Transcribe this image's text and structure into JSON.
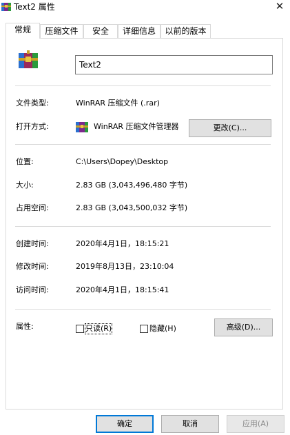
{
  "window": {
    "title": "Text2 属性",
    "close_glyph": "✕"
  },
  "tabs": [
    {
      "label": "常规",
      "active": true
    },
    {
      "label": "压缩文件",
      "active": false
    },
    {
      "label": "安全",
      "active": false
    },
    {
      "label": "详细信息",
      "active": false
    },
    {
      "label": "以前的版本",
      "active": false
    }
  ],
  "general": {
    "file_name": "Text2",
    "file_type_label": "文件类型:",
    "file_type_value": "WinRAR 压缩文件 (.rar)",
    "open_with_label": "打开方式:",
    "open_with_app": "WinRAR 压缩文件管理器",
    "change_button": "更改(C)...",
    "location_label": "位置:",
    "location_value": "C:\\Users\\Dopey\\Desktop",
    "size_label": "大小:",
    "size_value": "2.83 GB (3,043,496,480 字节)",
    "disk_size_label": "占用空间:",
    "disk_size_value": "2.83 GB (3,043,500,032 字节)",
    "created_label": "创建时间:",
    "created_value": "2020年4月1日，18:15:21",
    "modified_label": "修改时间:",
    "modified_value": "2019年8月13日，23:10:04",
    "accessed_label": "访问时间:",
    "accessed_value": "2020年4月1日，18:15:41",
    "attributes_label": "属性:",
    "readonly_label": "只读(R)",
    "readonly_checked": false,
    "hidden_label": "隐藏(H)",
    "hidden_checked": false,
    "advanced_button": "高级(D)..."
  },
  "footer": {
    "ok_button": "确定",
    "cancel_button": "取消",
    "apply_button": "应用(A)"
  },
  "icons": {
    "app_icon": "winrar-archive-icon"
  },
  "colors": {
    "accent": "#0078d7",
    "border": "#d9d9d9",
    "button_bg": "#e1e1e1"
  }
}
